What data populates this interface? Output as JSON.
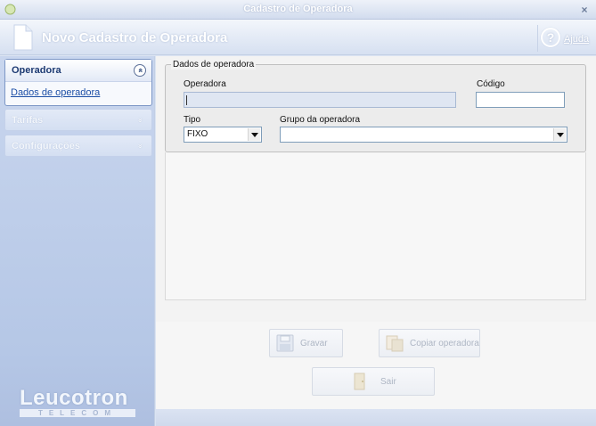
{
  "window": {
    "title": "Cadastro de Operadora",
    "close_glyph": "×"
  },
  "header": {
    "title": "Novo Cadastro de Operadora",
    "help_label": "Ajuda",
    "help_glyph": "?",
    "icon": "document-icon"
  },
  "sidebar": {
    "groups": [
      {
        "label": "Operadora",
        "expanded": true,
        "chevron": "»",
        "links": [
          "Dados de operadora"
        ]
      },
      {
        "label": "Tarifas",
        "expanded": false,
        "chevron": "»"
      },
      {
        "label": "Configurações",
        "expanded": false,
        "chevron": "»"
      }
    ],
    "logo": {
      "name": "Leucotron",
      "tagline": "TELECOM"
    }
  },
  "form": {
    "legend": "Dados de operadora",
    "fields": {
      "operadora": {
        "label": "Operadora",
        "value": ""
      },
      "codigo": {
        "label": "Código",
        "value": ""
      },
      "tipo": {
        "label": "Tipo",
        "value": "FIXO"
      },
      "grupo": {
        "label": "Grupo da operadora",
        "value": ""
      }
    }
  },
  "buttons": {
    "gravar": "Gravar",
    "copiar": "Copiar operadora",
    "sair": "Sair"
  },
  "colors": {
    "accent": "#1c3a72",
    "link": "#1d4fa6",
    "sidebar_bg": "#c9d6ee",
    "disabled_text": "#aeb6c4"
  }
}
